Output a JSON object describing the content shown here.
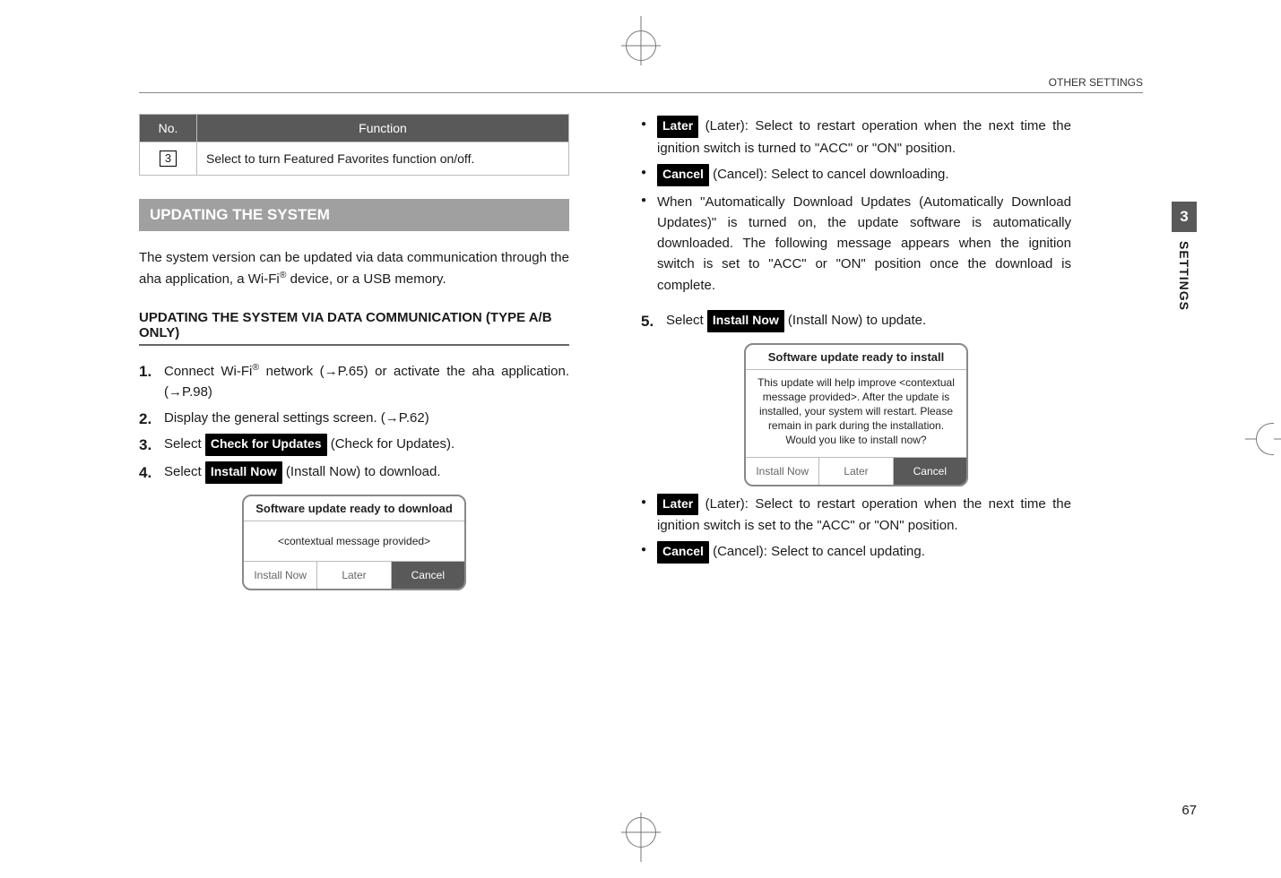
{
  "header": {
    "category": "OTHER SETTINGS"
  },
  "table": {
    "head_no": "No.",
    "head_fn": "Function",
    "row_num": "3",
    "row_fn": "Select to turn Featured Favorites function on/off."
  },
  "section_title": "UPDATING THE SYSTEM",
  "intro": "The system version can be updated via data communication through the aha application, a Wi-Fi® device, or a USB memory.",
  "subhead": "UPDATING THE SYSTEM VIA DATA COMMUNICATION (TYPE A/B ONLY)",
  "steps_left": {
    "s1": {
      "num": "1.",
      "a": "Connect Wi-Fi",
      "b": " network (→P.65) or activate the aha application. (→P.98)"
    },
    "s2": {
      "num": "2.",
      "text": "Display the general settings screen. (→P.62)"
    },
    "s3": {
      "num": "3.",
      "pre": "Select ",
      "btn": "Check for Updates",
      "post": " (Check for Updates)."
    },
    "s4": {
      "num": "4.",
      "pre": "Select ",
      "btn": "Install Now",
      "post": " (Install Now) to download."
    }
  },
  "dialog1": {
    "title": "Software update ready to download",
    "body": "<contextual message provided>",
    "install": "Install Now",
    "later": "Later",
    "cancel": "Cancel"
  },
  "right": {
    "b1": {
      "btn": "Later",
      "text": " (Later): Select to restart operation when the next time the ignition switch is turned to \"ACC\" or \"ON\" position."
    },
    "b2": {
      "btn": "Cancel",
      "text": " (Cancel): Select to cancel downloading."
    },
    "b3": {
      "text": "When \"Automatically Download Updates (Automatically Download Updates)\" is turned on, the update software is automatically downloaded. The following message appears when the ignition switch is set to \"ACC\" or \"ON\" position once the download is complete."
    },
    "s5": {
      "num": "5.",
      "pre": "Select ",
      "btn": "Install Now",
      "post": " (Install Now) to update."
    },
    "b4": {
      "btn": "Later",
      "text": " (Later): Select to restart operation when the next time the ignition switch is set to the \"ACC\" or \"ON\" position."
    },
    "b5": {
      "btn": "Cancel",
      "text": " (Cancel): Select to cancel updating."
    }
  },
  "dialog2": {
    "title": "Software update ready to install",
    "body": "This update will help improve <contextual message provided>. After the update is installed, your system will restart. Please remain in park during the installation. Would you like to install now?",
    "install": "Install Now",
    "later": "Later",
    "cancel": "Cancel"
  },
  "sidebar": {
    "chapter": "3",
    "label": "SETTINGS"
  },
  "page_number": "67"
}
